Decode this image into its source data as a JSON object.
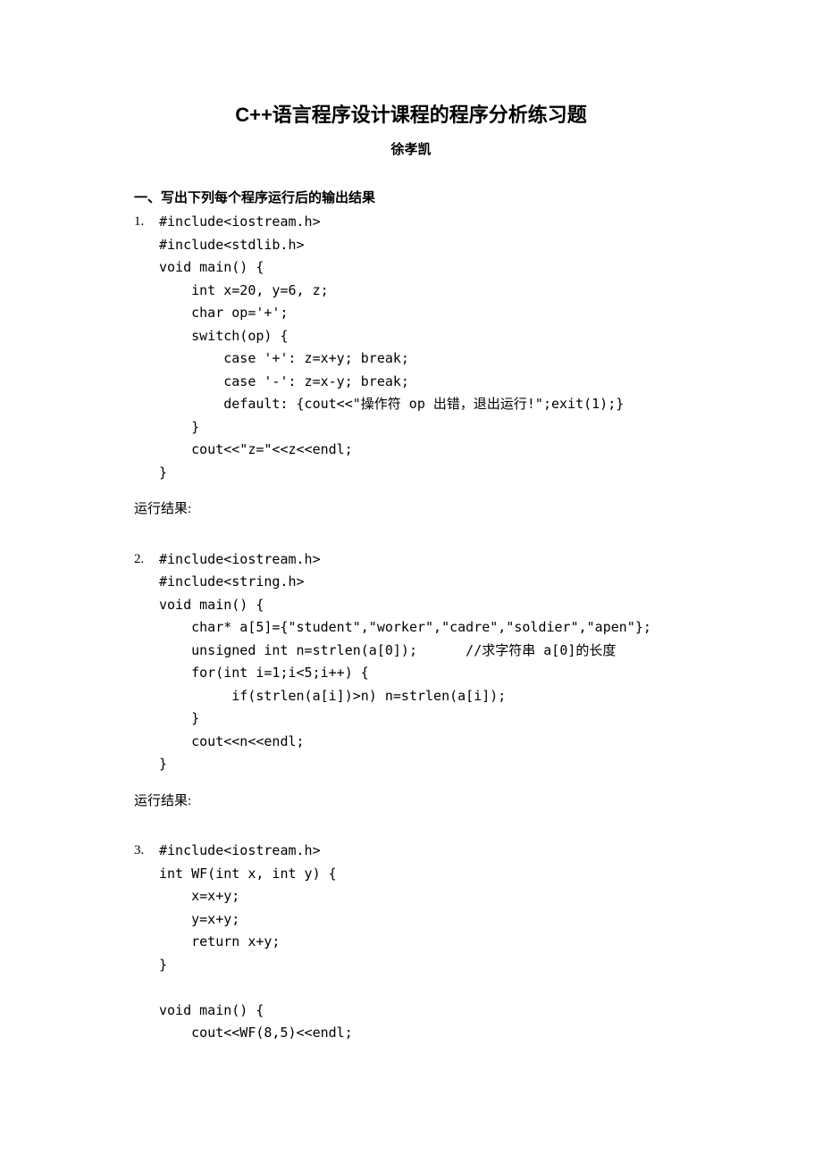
{
  "title": "C++语言程序设计课程的程序分析练习题",
  "author": "徐孝凯",
  "section_heading": "一、写出下列每个程序运行后的输出结果",
  "result_label": "运行结果:",
  "problems": [
    {
      "num": "1.",
      "first_line": "#include<iostream.h>",
      "code": "#include<stdlib.h>\nvoid main() {\n    int x=20, y=6, z;\n    char op='+';\n    switch(op) {\n        case '+': z=x+y; break;\n        case '-': z=x-y; break;\n        default: {cout<<\"操作符 op 出错，退出运行!\";exit(1);}\n    }\n    cout<<\"z=\"<<z<<endl;\n}"
    },
    {
      "num": "2.",
      "first_line": "#include<iostream.h>",
      "code": "#include<string.h>\nvoid main() {\n    char* a[5]={\"student\",\"worker\",\"cadre\",\"soldier\",\"apen\"};\n    unsigned int n=strlen(a[0]);      //求字符串 a[0]的长度\n    for(int i=1;i<5;i++) {\n         if(strlen(a[i])>n) n=strlen(a[i]);\n    }\n    cout<<n<<endl;\n}"
    },
    {
      "num": "3.",
      "first_line": "#include<iostream.h>",
      "code": "int WF(int x, int y) {\n    x=x+y;\n    y=x+y;\n    return x+y;\n}\n\nvoid main() {\n    cout<<WF(8,5)<<endl;"
    }
  ]
}
